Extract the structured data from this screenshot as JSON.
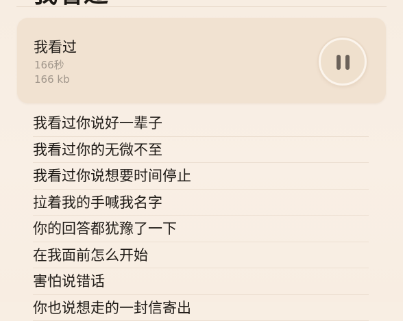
{
  "page": {
    "title": "我看过"
  },
  "audio": {
    "title": "我看过",
    "duration": "166秒",
    "size": "166 kb",
    "state": "playing",
    "control_icon": "pause-icon"
  },
  "lyrics": [
    "我看过你说好一辈子",
    "我看过你的无微不至",
    "我看过你说想要时间停止",
    "拉着我的手喊我名字",
    "你的回答都犹豫了一下",
    "在我面前怎么开始",
    "害怕说错话",
    "你也说想走的一封信寄出"
  ],
  "colors": {
    "background": "#f8eee3",
    "card": "#f1e2d1",
    "muted_text": "#a0968b",
    "icon": "#6b625a"
  }
}
